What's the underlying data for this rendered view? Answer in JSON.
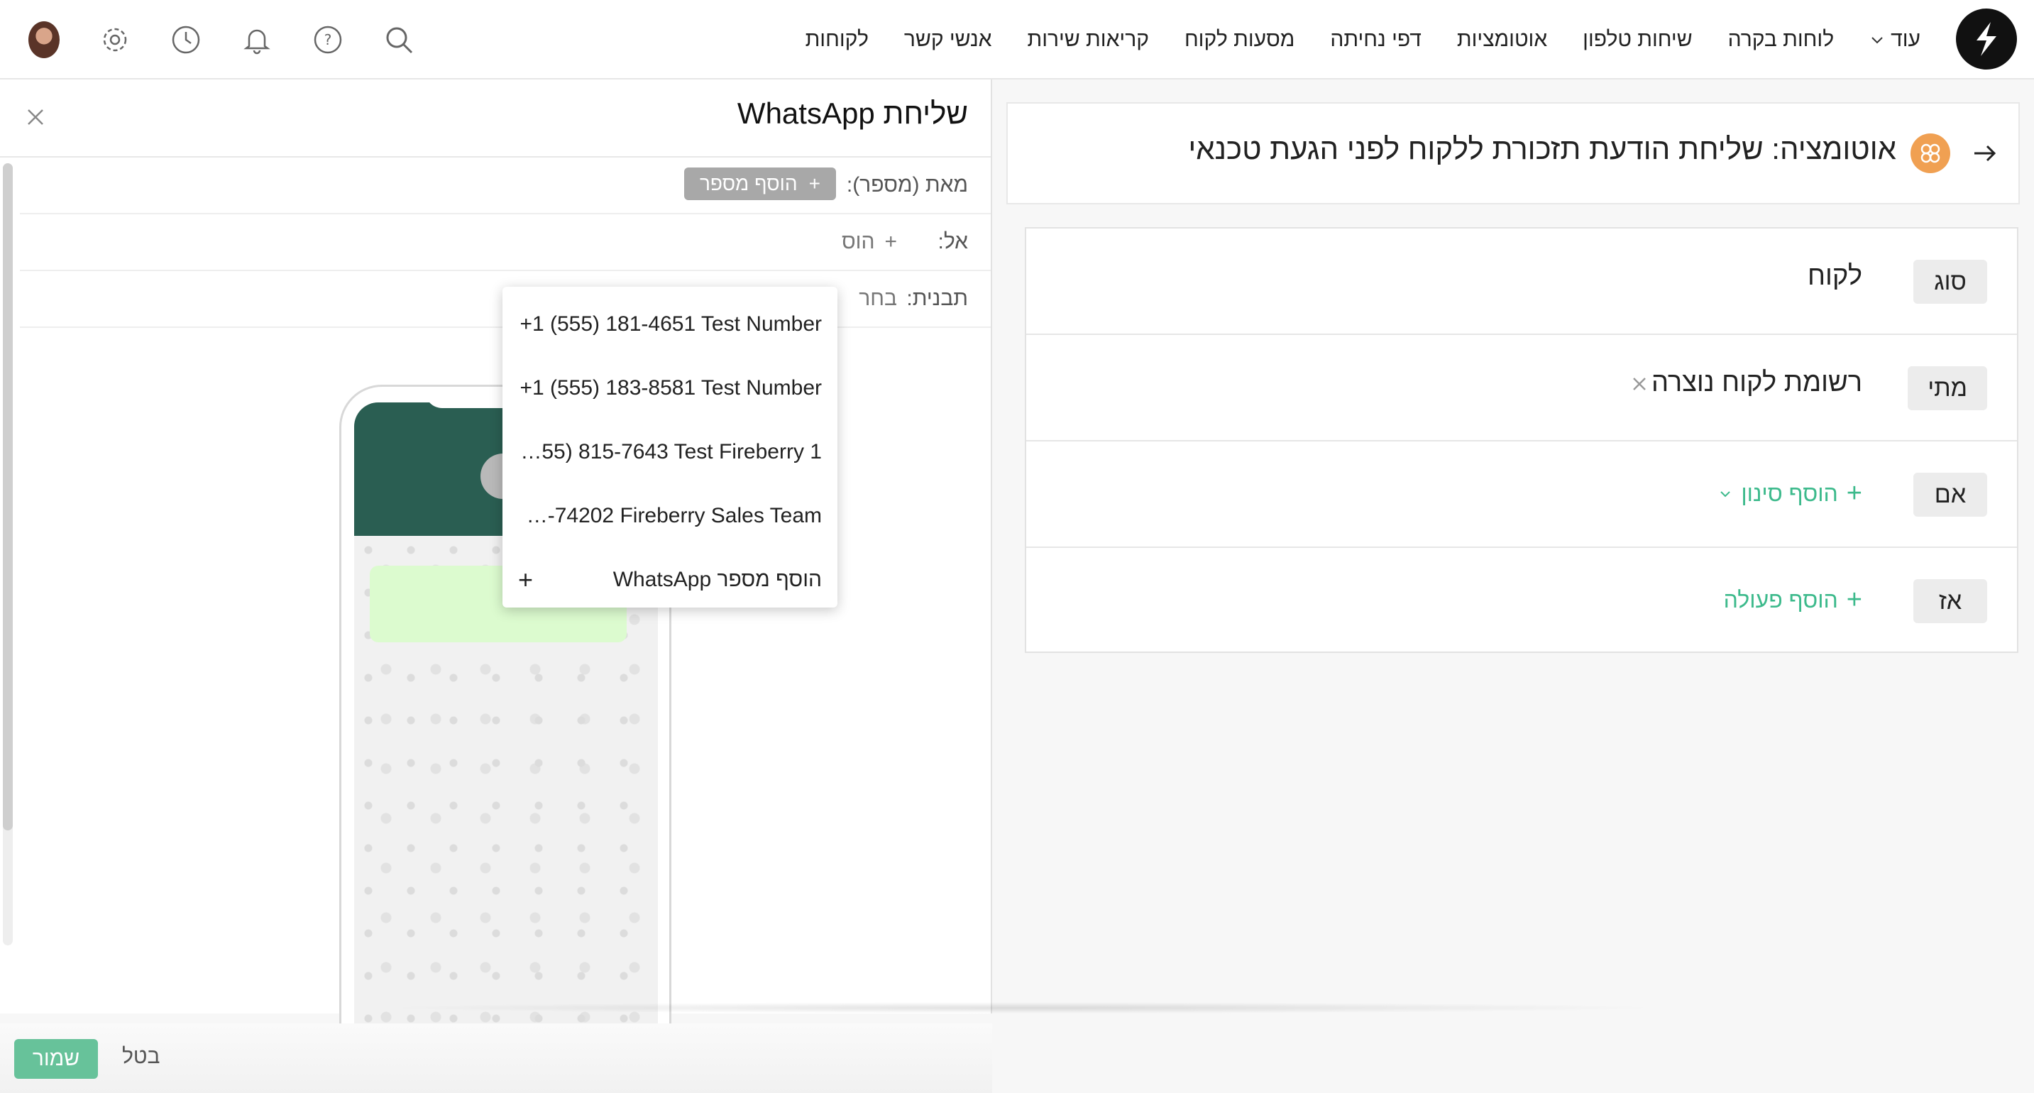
{
  "nav": {
    "items": [
      {
        "name": "nav-item-customers",
        "label": "לקוחות"
      },
      {
        "name": "nav-item-contacts",
        "label": "אנשי קשר"
      },
      {
        "name": "nav-item-service-calls",
        "label": "קריאות שירות"
      },
      {
        "name": "nav-item-customer-journeys",
        "label": "מסעות לקוח"
      },
      {
        "name": "nav-item-landing-pages",
        "label": "דפי נחיתה"
      },
      {
        "name": "nav-item-automations",
        "label": "אוטומציות"
      },
      {
        "name": "nav-item-phone-calls",
        "label": "שיחות טלפון"
      },
      {
        "name": "nav-item-dashboards",
        "label": "לוחות בקרה"
      }
    ],
    "more_label": "עוד"
  },
  "automation": {
    "title": "אוטומציה: שליחת הודעת תזכורת ללקוח לפני הגעת טכנאי",
    "rules": {
      "type": {
        "tag": "סוג",
        "value": "לקוח"
      },
      "when": {
        "tag": "מתי",
        "value": "רשומת לקוח נוצרה"
      },
      "if": {
        "tag": "אם",
        "add_label": "הוסף סינון"
      },
      "then": {
        "tag": "אז",
        "add_label": "הוסף פעולה"
      }
    }
  },
  "whatsapp": {
    "title": "שליחת WhatsApp",
    "from_label": "מאת (מספר):",
    "add_number_label": "הוסף מספר",
    "to_label": "אל:",
    "to_add_label": "הוס",
    "template_label": "תבנית:",
    "template_value": "בחר"
  },
  "dropdown": {
    "items": [
      "+1 (555) 181-4651 Test Number",
      "+1 (555) 183-8581 Test Number",
      "…55) 815-7643 Test Fireberry 1",
      "…-74202 Fireberry Sales Team"
    ],
    "add_label": "הוסף מספר WhatsApp"
  },
  "footer": {
    "save_label": "שמור",
    "cancel_label": "בטל"
  }
}
